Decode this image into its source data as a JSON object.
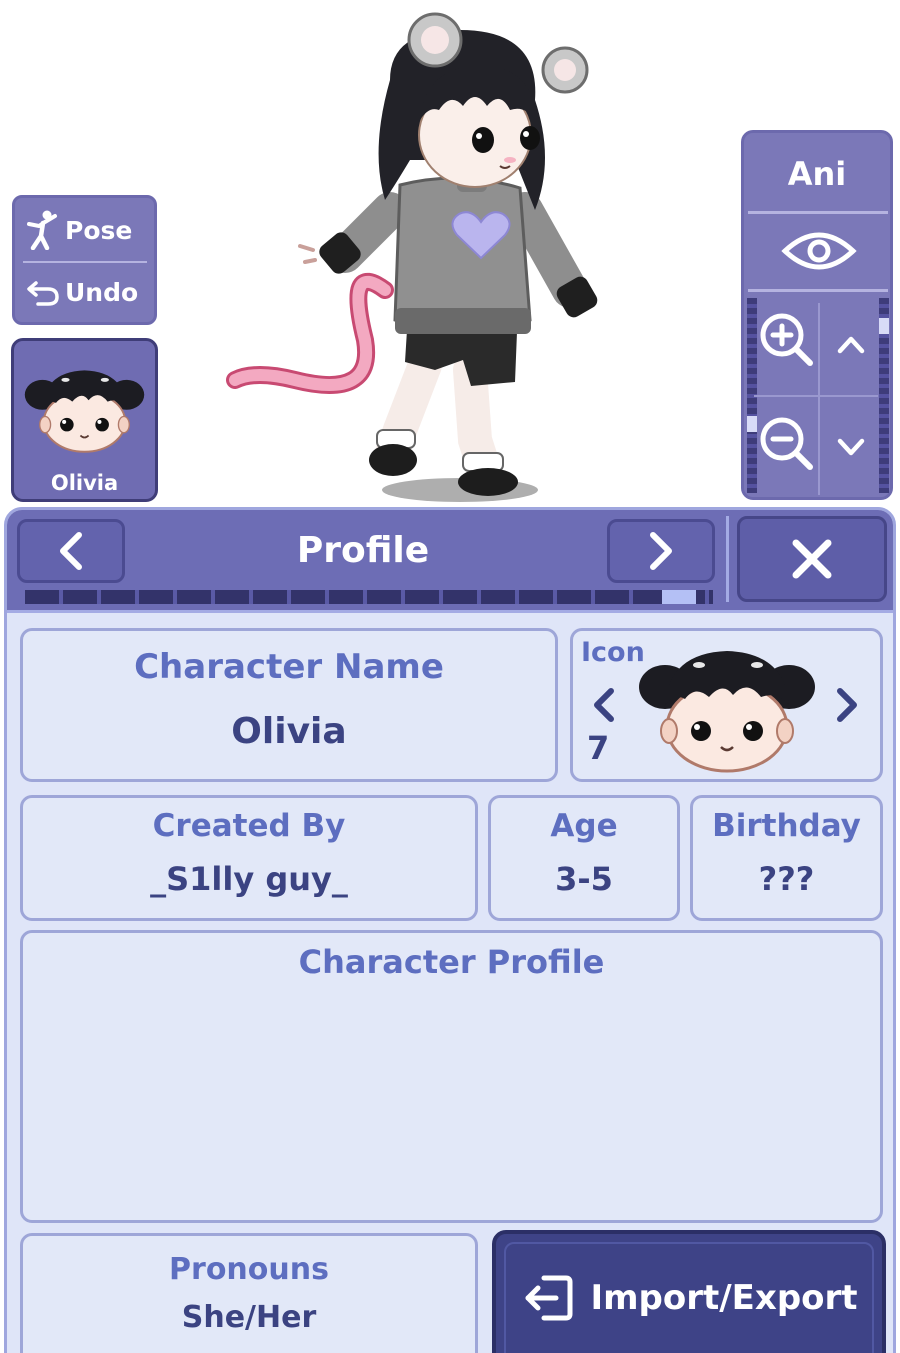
{
  "toolbar": {
    "pose_label": "Pose",
    "undo_label": "Undo"
  },
  "character_card": {
    "name": "Olivia"
  },
  "view_controls": {
    "ani_label": "Ani"
  },
  "panel": {
    "title": "Profile",
    "close_label": "X",
    "progress_fraction": 0.95
  },
  "profile": {
    "character_name_label": "Character Name",
    "character_name_value": "Olivia",
    "icon_label": "Icon",
    "icon_number": "7",
    "created_by_label": "Created By",
    "created_by_value": "_S1lly guy_",
    "age_label": "Age",
    "age_value": "3-5",
    "birthday_label": "Birthday",
    "birthday_value": "???",
    "character_profile_label": "Character Profile",
    "character_profile_value": "",
    "pronouns_label": "Pronouns",
    "pronouns_value": "She/Her",
    "import_export_label": "Import/Export"
  },
  "colors": {
    "header": "#6d6db5",
    "panel_bg": "#dfe5f8",
    "label": "#5d6ec0",
    "value": "#3b4382",
    "import_btn": "#3e4387"
  }
}
